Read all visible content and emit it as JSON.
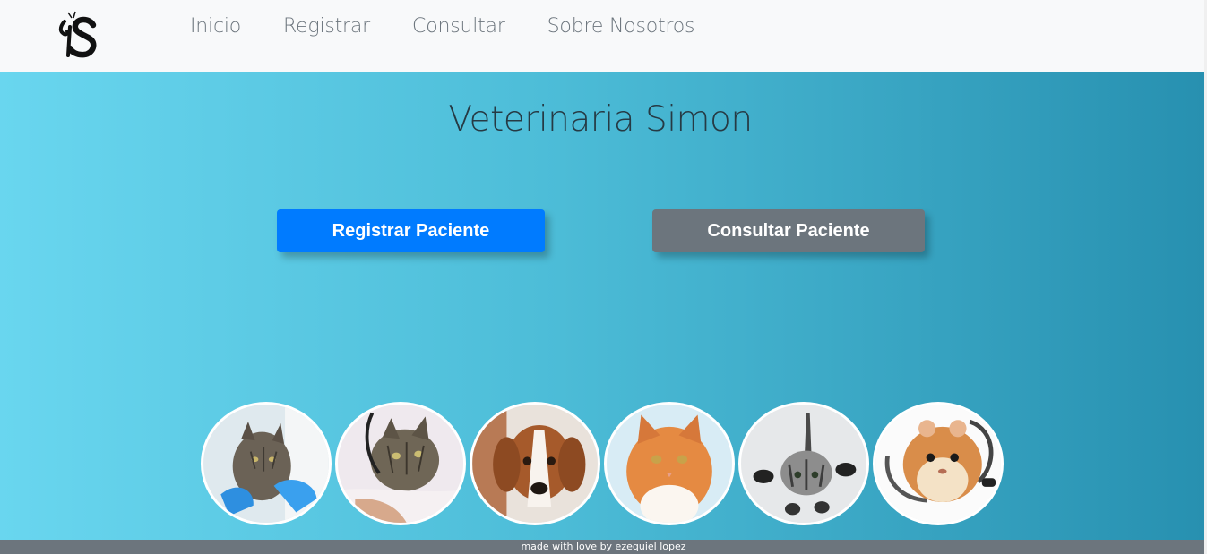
{
  "navbar": {
    "logo_icon": "veterinaria-s-logo-icon",
    "links": [
      {
        "label": "Inicio"
      },
      {
        "label": "Registrar"
      },
      {
        "label": "Consultar"
      },
      {
        "label": "Sobre Nosotros"
      }
    ]
  },
  "hero": {
    "title": "Veterinaria Simon",
    "register_button": "Registrar Paciente",
    "consult_button": "Consultar Paciente"
  },
  "gallery": {
    "photos": [
      {
        "subject": "tabby-cat-with-vet-gloves"
      },
      {
        "subject": "tabby-cat-with-stethoscope"
      },
      {
        "subject": "brown-white-puppy"
      },
      {
        "subject": "orange-fluffy-cat"
      },
      {
        "subject": "jumping-grey-kitten"
      },
      {
        "subject": "hamster-with-stethoscope"
      }
    ]
  },
  "footer": {
    "text": "made with love by ezequiel lopez"
  },
  "colors": {
    "navbar_bg": "#f8f9fa",
    "nav_text": "#6c757d",
    "hero_gradient_start": "#69d6ef",
    "hero_gradient_end": "#2790b0",
    "primary_button": "#007bff",
    "secondary_button": "#6c757d",
    "title_text": "#263a44",
    "footer_bg": "#6c757d"
  }
}
